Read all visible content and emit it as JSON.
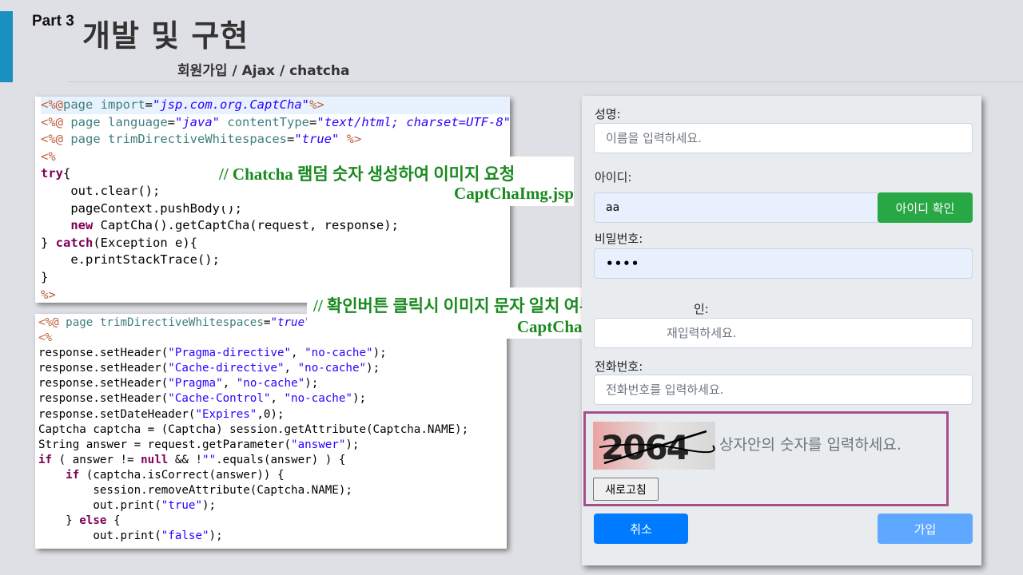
{
  "header": {
    "part": "Part 3",
    "title": "개발 및 구현",
    "subtitle": "회원가입 / Ajax / chatcha"
  },
  "code_captcha_img": {
    "lines": [
      "<%@page import=\"jsp.com.org.CaptCha\"%>",
      "<%@ page language=\"java\" contentType=\"text/html; charset=UTF-8\"",
      "<%@ page trimDirectiveWhitespaces=\"true\" %>",
      "<%",
      "try{",
      "    out.clear();",
      "    pageContext.pushBody();",
      "    new CaptCha().getCaptCha(request, response);",
      "} catch(Exception e){",
      "    e.printStackTrace();",
      "}",
      "%>"
    ]
  },
  "code_captcha_submit": {
    "lines": [
      "<%@ page trimDirectiveWhitespaces=\"true\" %>",
      "<%",
      "response.setHeader(\"Pragma-directive\", \"no-cache\");",
      "response.setHeader(\"Cache-directive\", \"no-cache\");",
      "response.setHeader(\"Pragma\", \"no-cache\");",
      "response.setHeader(\"Cache-Control\", \"no-cache\");",
      "response.setDateHeader(\"Expires\",0);",
      "Captcha captcha = (Captcha) session.getAttribute(Captcha.NAME);",
      "String answer = request.getParameter(\"answer\");",
      "if ( answer != null && !\"\".equals(answer) ) {",
      "    if (captcha.isCorrect(answer)) {",
      "        session.removeAttribute(Captcha.NAME);",
      "        out.print(\"true\");",
      "    } else {",
      "        out.print(\"false\");"
    ]
  },
  "annotation_1": {
    "comment": "// Chatcha 램덤 숫자 생성하여 이미지 요청",
    "file": "CaptChaImg.jsp"
  },
  "annotation_2": {
    "comment": "// 확인버튼 클릭시 이미지 문자 일치 여부",
    "file": "CaptChaSubmit.jsp"
  },
  "form": {
    "name_label": "성명:",
    "name_placeholder": "이름을 입력하세요.",
    "id_label": "아이디:",
    "id_value": "aa",
    "id_check_button": "아이디 확인",
    "password_label": "비밀번호:",
    "password_value": "••••",
    "password_confirm_label": "인:",
    "password_confirm_placeholder": "재입력하세요.",
    "phone_label": "전화번호:",
    "phone_placeholder": "전화번호를 입력하세요.",
    "captcha_text": "2064",
    "captcha_hint": "상자안의 숫자를 입력하세요.",
    "refresh_button": "새로고침",
    "cancel_button": "취소",
    "join_button": "가입"
  },
  "colors": {
    "accent_bar": "#1a8fc2",
    "annotation_text": "#1a8a1f",
    "captcha_border": "#a64f8c",
    "id_check_button": "#28a745",
    "cancel_button": "#007bff",
    "join_button": "#5ea8ff"
  }
}
